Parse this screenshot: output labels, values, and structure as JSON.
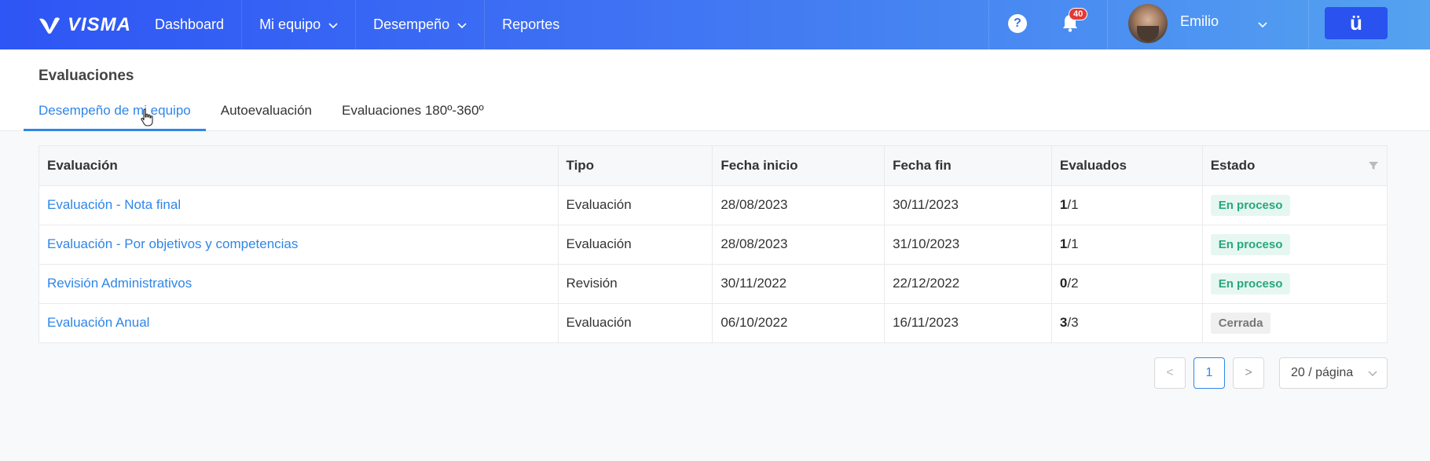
{
  "brand": {
    "name": "VISMA"
  },
  "nav": {
    "items": [
      {
        "label": "Dashboard",
        "has_dropdown": false
      },
      {
        "label": "Mi equipo",
        "has_dropdown": true
      },
      {
        "label": "Desempeño",
        "has_dropdown": true
      },
      {
        "label": "Reportes",
        "has_dropdown": false
      }
    ]
  },
  "topbar": {
    "help_icon": "question-circle-icon",
    "notifications_count": "40",
    "user_name": "Emilio",
    "app_button_label": "ü"
  },
  "page": {
    "title": "Evaluaciones",
    "tabs": [
      {
        "label": "Desempeño de mi equipo",
        "active": true
      },
      {
        "label": "Autoevaluación",
        "active": false
      },
      {
        "label": "Evaluaciones 180º-360º",
        "active": false
      }
    ]
  },
  "table": {
    "columns": [
      "Evaluación",
      "Tipo",
      "Fecha inicio",
      "Fecha fin",
      "Evaluados",
      "Estado"
    ],
    "rows": [
      {
        "name": "Evaluación - Nota final",
        "tipo": "Evaluación",
        "inicio": "28/08/2023",
        "fin": "30/11/2023",
        "evaluados_done": "1",
        "evaluados_total": "/1",
        "estado": "En proceso"
      },
      {
        "name": "Evaluación - Por objetivos y competencias",
        "tipo": "Evaluación",
        "inicio": "28/08/2023",
        "fin": "31/10/2023",
        "evaluados_done": "1",
        "evaluados_total": "/1",
        "estado": "En proceso"
      },
      {
        "name": "Revisión Administrativos",
        "tipo": "Revisión",
        "inicio": "30/11/2022",
        "fin": "22/12/2022",
        "evaluados_done": "0",
        "evaluados_total": "/2",
        "estado": "En proceso"
      },
      {
        "name": "Evaluación Anual",
        "tipo": "Evaluación",
        "inicio": "06/10/2022",
        "fin": "16/11/2023",
        "evaluados_done": "3",
        "evaluados_total": "/3",
        "estado": "Cerrada"
      }
    ]
  },
  "pagination": {
    "prev": "<",
    "current": "1",
    "next": ">",
    "page_size": "20 / página"
  },
  "colors": {
    "accent": "#2f86e8",
    "status_in_progress": "#27a77e",
    "status_closed": "#777777"
  }
}
